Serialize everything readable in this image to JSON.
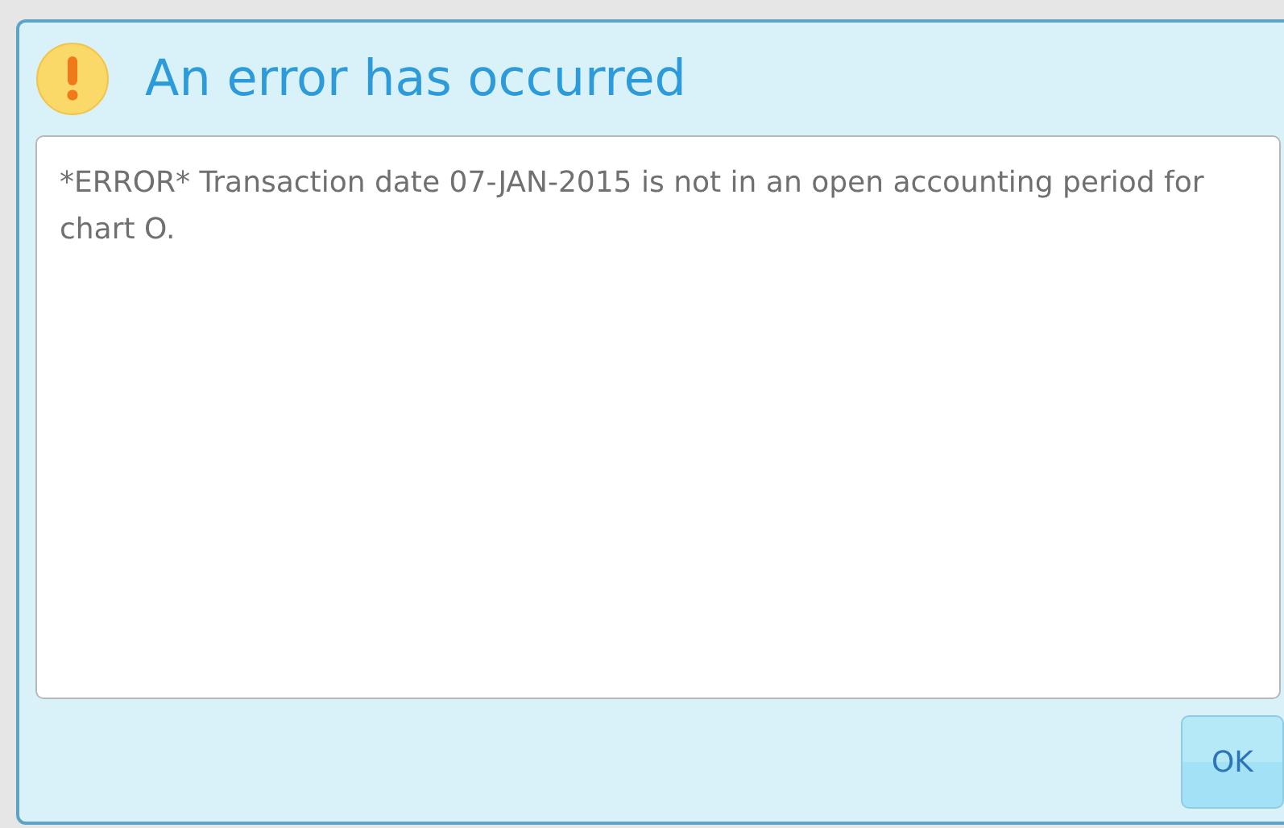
{
  "dialog": {
    "title": "An error has occurred",
    "message": "*ERROR* Transaction date 07-JAN-2015 is not in an open accounting period for chart O.",
    "buttons": [
      {
        "label": "OK"
      }
    ]
  }
}
